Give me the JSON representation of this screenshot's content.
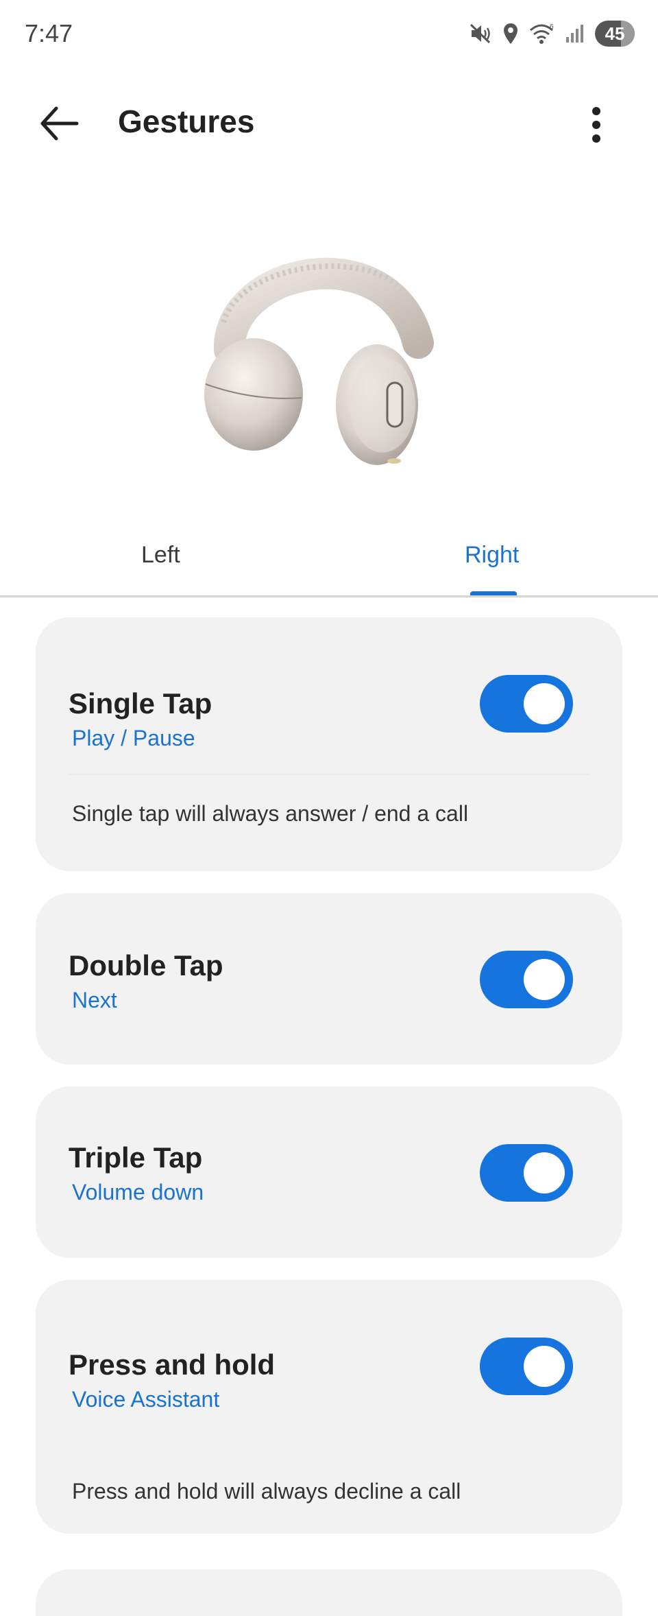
{
  "status_bar": {
    "time": "7:47",
    "battery": "45",
    "icons": [
      "mute-vibrate-icon",
      "location-icon",
      "wifi-icon",
      "signal-icon",
      "battery-icon"
    ]
  },
  "app_bar": {
    "title": "Gestures",
    "back_icon": "arrow-left-icon",
    "menu_icon": "more-vertical-icon"
  },
  "device": {
    "image": "open-ear-headphones-illustration"
  },
  "tabs": {
    "items": [
      {
        "label": "Left",
        "selected": false
      },
      {
        "label": "Right",
        "selected": true
      }
    ]
  },
  "gestures": [
    {
      "title": "Single Tap",
      "action": "Play / Pause",
      "enabled": true,
      "note": "Single tap will always answer / end a call"
    },
    {
      "title": "Double Tap",
      "action": "Next",
      "enabled": true
    },
    {
      "title": "Triple Tap",
      "action": "Volume down",
      "enabled": true
    },
    {
      "title": "Press and hold",
      "action": "Voice Assistant",
      "enabled": true,
      "note": "Press and hold will always decline a call"
    }
  ],
  "colors": {
    "accent": "#1a73d0",
    "toggle_on": "#1574dd",
    "card_bg": "#f2f2f2"
  }
}
